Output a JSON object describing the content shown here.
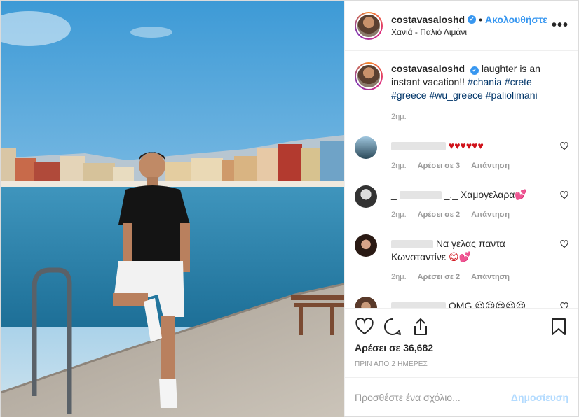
{
  "header": {
    "username": "costavasaloshd",
    "verified_glyph": "✔",
    "separator": "•",
    "follow_label": "Ακολουθήστε",
    "location": "Χανιά - Παλιό Λιμάνι",
    "more_label": "•••"
  },
  "caption": {
    "username": "costavasaloshd",
    "text": "laughter is an instant vacation!!",
    "hashtags": [
      "#chania",
      "#crete",
      "#greece",
      "#wu_greece",
      "#paliolimani"
    ],
    "time": "2ημ."
  },
  "comments": [
    {
      "text": "♥♥♥♥♥♥",
      "time": "2ημ.",
      "likes": "Αρέσει σε 3",
      "reply": "Απάντηση"
    },
    {
      "text_prefix": "_",
      "text_mid": "_._",
      "text": "Χαμογελαρα",
      "emoji": "💕",
      "time": "2ημ.",
      "likes": "Αρέσει σε 2",
      "reply": "Απάντηση"
    },
    {
      "text": "Να γελας παντα Κωνσταντίνε",
      "emoji": "😊💕",
      "time": "2ημ.",
      "likes": "Αρέσει σε 2",
      "reply": "Απάντηση"
    },
    {
      "text": "OMG",
      "emoji": "😍😍😍😍😍"
    }
  ],
  "actions": {
    "likes_count": "Αρέσει σε 36,682",
    "posted_ago": "ΠΡΙΝ ΑΠΟ 2 ΗΜΕΡΕΣ",
    "add_comment_placeholder": "Προσθέστε ένα σχόλιο...",
    "post_label": "Δημοσίευση"
  },
  "colors": {
    "accent": "#3897f0",
    "hashtag": "#003569",
    "muted": "#999999",
    "post_disabled": "#b3dbff",
    "heart_red": "#d0121a"
  },
  "icons": [
    "more-options-icon",
    "verified-badge-icon",
    "like-heart-icon",
    "comment-bubble-icon",
    "share-icon",
    "save-bookmark-icon",
    "comment-like-heart-icon"
  ]
}
